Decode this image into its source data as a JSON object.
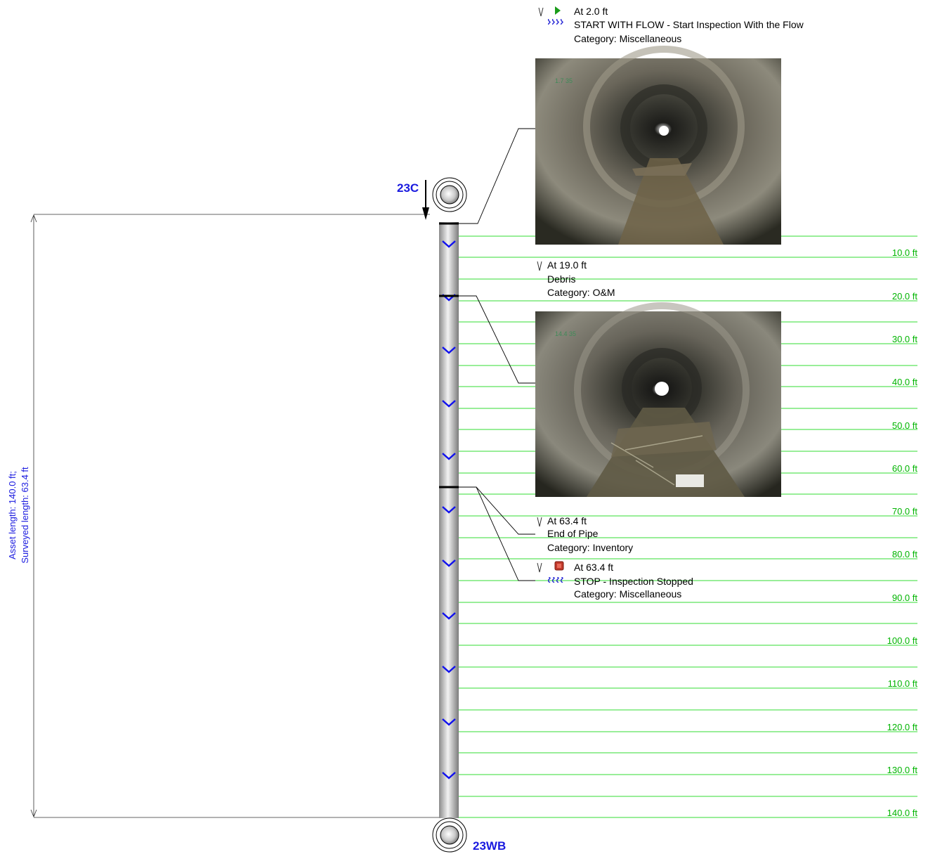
{
  "manholes": {
    "upstream": "23C",
    "downstream": "23WB"
  },
  "lengths": {
    "asset": "Asset length: 140.0 ft;",
    "surveyed": "Surveyed length: 63.4 ft"
  },
  "distance_marks": [
    "10.0 ft",
    "20.0 ft",
    "30.0 ft",
    "40.0 ft",
    "50.0 ft",
    "60.0 ft",
    "70.0 ft",
    "80.0 ft",
    "90.0 ft",
    "100.0 ft",
    "110.0 ft",
    "120.0 ft",
    "130.0 ft",
    "140.0 ft"
  ],
  "observations": [
    {
      "at": "At 2.0 ft",
      "description": "START WITH FLOW - Start Inspection With the Flow",
      "category": "Category: Miscellaneous",
      "icon": "start-flow-icon",
      "has_photo": true
    },
    {
      "at": "At 19.0 ft",
      "description": "Debris",
      "category": "Category: O&M",
      "icon": "",
      "has_photo": true
    },
    {
      "at": "At 63.4 ft",
      "description": "End of Pipe",
      "category": "Category: Inventory",
      "icon": "",
      "has_photo": false
    },
    {
      "at": "At 63.4 ft",
      "description": "STOP - Inspection Stopped",
      "category": "Category: Miscellaneous",
      "icon": "stop-icon",
      "has_photo": false
    }
  ],
  "colors": {
    "grid_line": "#33dd33",
    "grid_text": "#00b400",
    "manhole_label": "#1a1adf",
    "flow_chevron": "#1010ee"
  }
}
